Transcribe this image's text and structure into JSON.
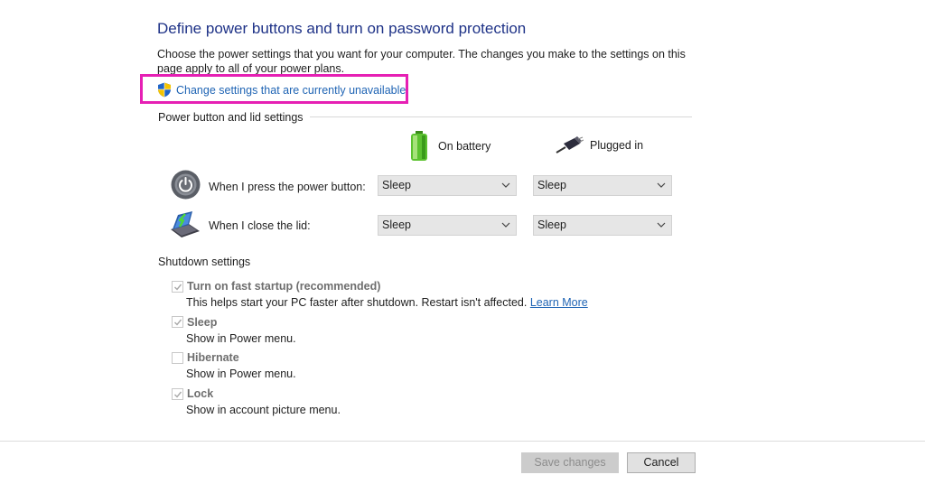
{
  "page": {
    "title": "Define power buttons and turn on password protection",
    "description": "Choose the power settings that you want for your computer. The changes you make to the settings on this page apply to all of your power plans.",
    "change_settings_link": "Change settings that are currently unavailable"
  },
  "power_buttons": {
    "group_label": "Power button and lid settings",
    "columns": {
      "battery": "On battery",
      "plugged": "Plugged in"
    },
    "rows": [
      {
        "label": "When I press the power button:",
        "icon": "power-button-icon",
        "battery": "Sleep",
        "plugged": "Sleep"
      },
      {
        "label": "When I close the lid:",
        "icon": "laptop-lid-icon",
        "battery": "Sleep",
        "plugged": "Sleep"
      }
    ]
  },
  "shutdown": {
    "group_label": "Shutdown settings",
    "options": [
      {
        "title": "Turn on fast startup (recommended)",
        "desc": "This helps start your PC faster after shutdown. Restart isn't affected.",
        "link": "Learn More",
        "checked": true
      },
      {
        "title": "Sleep",
        "desc": "Show in Power menu.",
        "checked": true
      },
      {
        "title": "Hibernate",
        "desc": "Show in Power menu.",
        "checked": false
      },
      {
        "title": "Lock",
        "desc": "Show in account picture menu.",
        "checked": true
      }
    ]
  },
  "buttons": {
    "save": "Save changes",
    "cancel": "Cancel"
  },
  "colors": {
    "title": "#1e3287",
    "link": "#1f64b4",
    "highlight": "#e620b4"
  }
}
